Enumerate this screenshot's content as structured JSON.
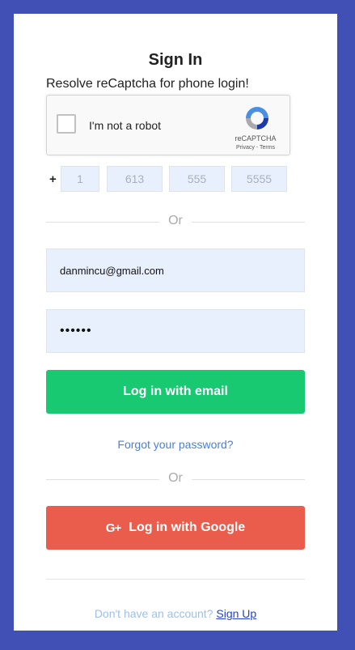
{
  "title": "Sign In",
  "captcha": {
    "message": "Resolve reCaptcha for phone login!",
    "checkbox_label": "I'm not a robot",
    "brand": "reCAPTCHA",
    "links": "Privacy - Terms"
  },
  "phone": {
    "prefix": "+",
    "country_placeholder": "1",
    "area_placeholder": "613",
    "exchange_placeholder": "555",
    "line_placeholder": "5555"
  },
  "divider_text": "Or",
  "email": {
    "value": "danmincu@gmail.com"
  },
  "password": {
    "value": "••••••"
  },
  "buttons": {
    "email_login": "Log in with email",
    "google_login": "Log in with Google",
    "google_icon": "G+"
  },
  "forgot_password": "Forgot your password?",
  "signup": {
    "prompt": "Don't have an account?",
    "link": "Sign Up"
  },
  "colors": {
    "background": "#4150b5",
    "email_button": "#19c972",
    "google_button": "#ea5d4d",
    "link": "#4a7fd6"
  }
}
